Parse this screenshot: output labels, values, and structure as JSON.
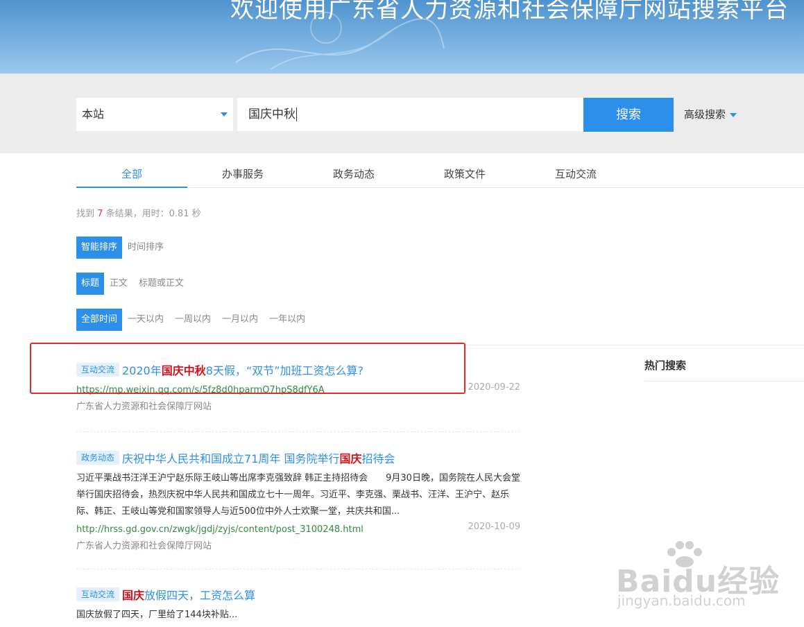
{
  "banner": {
    "title": "欢迎使用广东省人力资源和社会保障厅网站搜索平台"
  },
  "search": {
    "scope_value": "本站",
    "query": "国庆中秋",
    "button_label": "搜索",
    "advanced_label": "高级搜索"
  },
  "tabs": [
    {
      "label": "全部",
      "active": true
    },
    {
      "label": "办事服务",
      "active": false
    },
    {
      "label": "政务动态",
      "active": false
    },
    {
      "label": "政策文件",
      "active": false
    },
    {
      "label": "互动交流",
      "active": false
    }
  ],
  "summary": {
    "prefix": "找到",
    "count": "7",
    "suffix": "条结果，用时：0.81 秒"
  },
  "filters": {
    "sort": {
      "selected": "智能排序",
      "other": "时间排序"
    },
    "field": {
      "selected": "标题",
      "options": [
        "正文",
        "标题或正文"
      ]
    },
    "time": {
      "selected": "全部时间",
      "options": [
        "一天以内",
        "一周以内",
        "一月以内",
        "一年以内"
      ]
    }
  },
  "results": [
    {
      "tag": "互动交流",
      "title_pre": "2020年",
      "title_hl": "国庆中秋",
      "title_post": "8天假，“双节”加班工资怎么算?",
      "url": "https://mp.weixin.qq.com/s/5fz8d0hparmO7hpS8dfY6A",
      "date": "2020-09-22",
      "source": "广东省人力资源和社会保障厅网站"
    },
    {
      "tag": "政务动态",
      "title_pre": "庆祝中华人民共和国成立71周年 国务院举行",
      "title_hl": "国庆",
      "title_post": "招待会",
      "snippet": "习近平栗战书汪洋王沪宁赵乐际王岐山等出席李克强致辞 韩正主持招待会　　9月30日晚，国务院在人民大会堂举行国庆招待会，热烈庆祝中华人民共和国成立七十一周年。习近平、李克强、栗战书、汪洋、王沪宁、赵乐际、韩正、王岐山等党和国家领导人与近500位中外人士欢聚一堂，共庆共和国...",
      "url": "http://hrss.gd.gov.cn/zwgk/jgdj/zyjs/content/post_3100248.html",
      "date": "2020-10-09",
      "source": "广东省人力资源和社会保障厅网站"
    },
    {
      "tag": "互动交流",
      "title_pre": "",
      "title_hl": "国庆",
      "title_post": "放假四天，工资怎么算",
      "snippet": "国庆放假了四天，厂里给了144块补贴..."
    }
  ],
  "sidebar": {
    "hot_title": "热门搜索"
  },
  "watermark": {
    "brand": "Baidu经验",
    "domain": "jingyan.baidu.com"
  },
  "colors": {
    "accent": "#2c8fea",
    "highlight": "#d0121b",
    "url": "#2e8b3d",
    "annotation": "#e52a2a"
  }
}
